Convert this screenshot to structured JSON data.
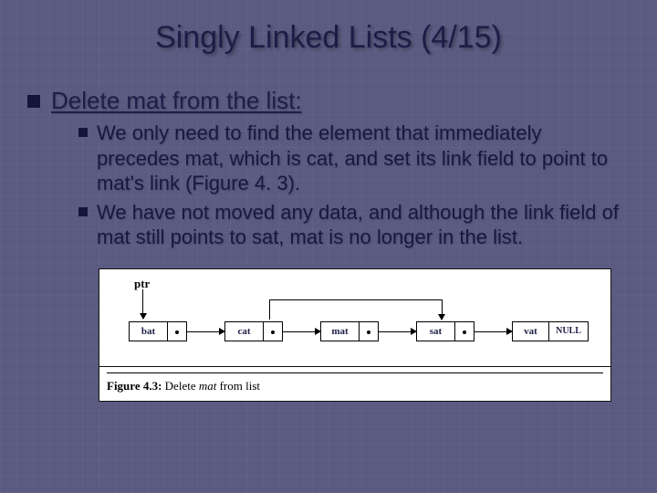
{
  "title": "Singly Linked Lists (4/15)",
  "bullet1": "Delete mat from the list:",
  "sub1": "We only need to find the element that immediately precedes mat, which is cat, and set its link field to point to mat's link (Figure 4. 3).",
  "sub2": "We have not moved any data, and although the link field of mat still points to sat, mat is no longer in the list.",
  "figure": {
    "ptr_label": "ptr",
    "nodes": [
      "bat",
      "cat",
      "mat",
      "sat",
      "vat"
    ],
    "null_label": "NULL",
    "caption_prefix": "Figure 4.3:",
    "caption_rest_a": " Delete ",
    "caption_word": "mat",
    "caption_rest_b": " from list"
  }
}
